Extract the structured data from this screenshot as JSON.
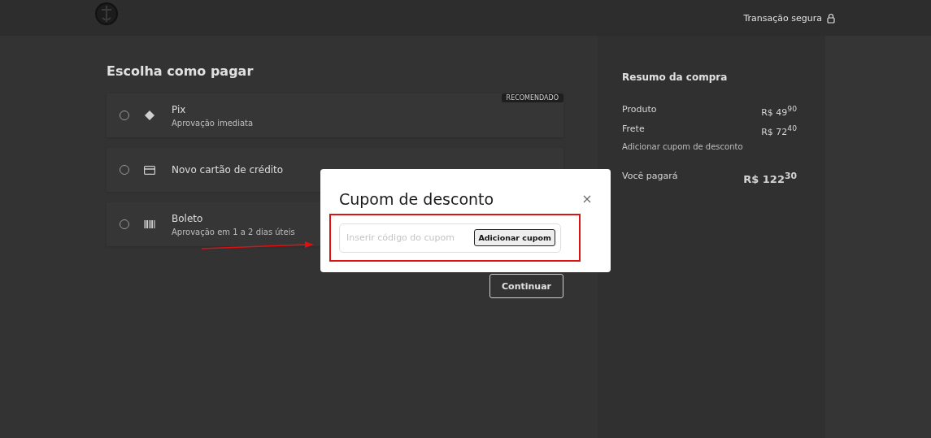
{
  "header": {
    "secure_label": "Transação segura"
  },
  "payment": {
    "title": "Escolha como pagar",
    "methods": [
      {
        "kind": "pix",
        "name": "Pix",
        "detail": "Aprovação imediata",
        "badge": "RECOMENDADO",
        "selected": false
      },
      {
        "kind": "card",
        "name": "Novo cartão de crédito",
        "selected": false
      },
      {
        "kind": "boleto",
        "name": "Boleto",
        "detail": "Aprovação em 1 a 2 dias úteis",
        "selected": false
      }
    ],
    "continue_button": "Continuar"
  },
  "summary": {
    "title": "Resumo da compra",
    "lines": [
      {
        "label": "Produto",
        "value": "R$ 49$^{90}$"
      },
      {
        "label": "Frete",
        "value": "R$ 72$^{40}$"
      }
    ],
    "coupon_link": "Adicionar cupom de desconto",
    "total_label": "Você pagará",
    "total_value": "R$ 122$^{30}$"
  },
  "modal": {
    "title": "Cupom de desconto",
    "placeholder": "Inserir código do cupom",
    "apply_button": "Adicionar cupom"
  }
}
